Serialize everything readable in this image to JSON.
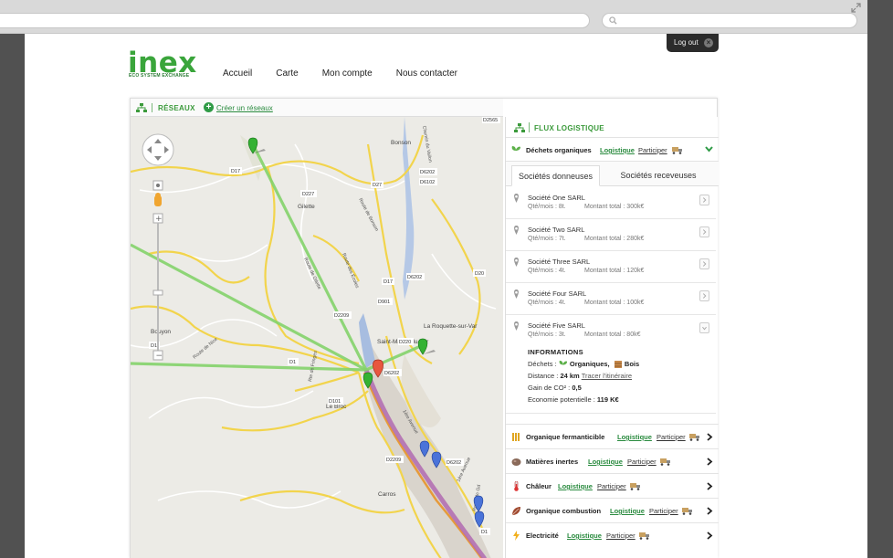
{
  "page": {
    "logout_label": "Log out",
    "logo_word": "inex",
    "logo_tagline": "ECO SYSTEM EXCHANGE",
    "nav": [
      "Accueil",
      "Carte",
      "Mon compte",
      "Nous contacter"
    ]
  },
  "toolbar": {
    "networks_label": "RÉSEAUX",
    "create_label": "Créer un réseaux"
  },
  "map": {
    "labels": {
      "bonson": "Bonson",
      "gilette": "Gilette",
      "roquette": "La Roquette-sur-Var",
      "saint_martin": "Saint-Martin-du-Var",
      "bouyon": "Bouyon",
      "le_broc": "Le Broc",
      "carros": "Carros",
      "d17a": "D17",
      "d227": "D227",
      "d27": "D27",
      "d6202a": "D6202",
      "d6102": "D6102",
      "d2565": "D2565",
      "d17b": "D17",
      "d6202b": "D6202",
      "d20": "D20",
      "d901": "D901",
      "d2209": "D2209",
      "d220": "D220",
      "d1a": "D1",
      "d1b": "D1",
      "d6202c": "D6202",
      "d101": "D101",
      "d2209b": "D2209",
      "d6202d": "D6202",
      "d1c": "D1",
      "route_bonson": "Route de Bonson",
      "route_nice": "Route de Nice",
      "route_ecoles": "Route des Écoles",
      "route_gilette": "Route de Gilette",
      "chemin_vallon": "Chemin du Vallon",
      "route_fringes": "Rte de Fringes",
      "avenue_1": "1ère Avenue",
      "avenue_2": "1ère Avenue",
      "route_gd": "Route de Gd"
    },
    "pin_colors": {
      "green": "#34b233",
      "red": "#e8573f",
      "blue": "#4a73d9"
    },
    "route_colors": {
      "green_line": "#84d36a",
      "purple_line": "#a55ba6"
    }
  },
  "panel": {
    "title": "FLUX LOGISTIQUE",
    "open_category": {
      "name": "Déchets organiques",
      "logistique": "Logistique",
      "participer": "Participer"
    },
    "tabs": [
      "Sociétés donneuses",
      "Sociétés receveuses"
    ],
    "companies": [
      {
        "name": "Société One SARL",
        "qty": "Qté/mois : 8t.",
        "amount": "Montant total : 300k€"
      },
      {
        "name": "Société Two SARL",
        "qty": "Qté/mois : 7t.",
        "amount": "Montant total : 280k€"
      },
      {
        "name": "Société Three SARL",
        "qty": "Qté/mois : 4t.",
        "amount": "Montant total : 120k€"
      },
      {
        "name": "Société Four SARL",
        "qty": "Qté/mois : 4t.",
        "amount": "Montant total : 100k€"
      },
      {
        "name": "Société Five SARL",
        "qty": "Qté/mois : 3t.",
        "amount": "Montant total : 80k€"
      }
    ],
    "info": {
      "title": "INFORMATIONS",
      "dechets_label": "Déchets :",
      "dechets_value1": "Organiques,",
      "dechets_value2": "Bois",
      "distance_label": "Distance :",
      "distance_value": "24 km",
      "distance_link": "Tracer l'itinéraire",
      "co2_label": "Gain de CO² :",
      "co2_value": "0,5",
      "eco_label": "Economie potentielle :",
      "eco_value": "119 K€"
    },
    "categories": [
      {
        "name": "Organique fermanticible",
        "logistique": "Logistique",
        "participer": "Participer"
      },
      {
        "name": "Matières inertes",
        "logistique": "Logistique",
        "participer": "Participer"
      },
      {
        "name": "Châleur",
        "logistique": "Logistique",
        "participer": "Participer"
      },
      {
        "name": "Organique combustion",
        "logistique": "Logistique",
        "participer": "Participer"
      },
      {
        "name": "Electricité",
        "logistique": "Logistique",
        "participer": "Participer"
      }
    ]
  }
}
